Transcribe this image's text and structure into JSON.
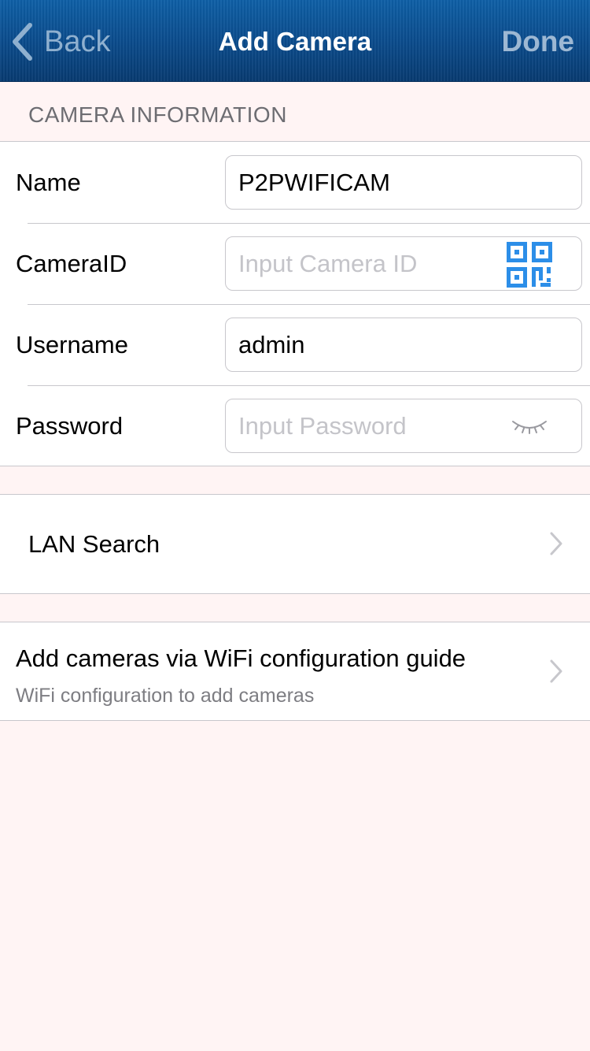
{
  "navbar": {
    "back_label": "Back",
    "title": "Add Camera",
    "done_label": "Done",
    "background_color": "#0a4a8a"
  },
  "section": {
    "header": "CAMERA INFORMATION"
  },
  "form": {
    "name": {
      "label": "Name",
      "value": "P2PWIFICAM",
      "placeholder": ""
    },
    "camera_id": {
      "label": "CameraID",
      "value": "",
      "placeholder": "Input Camera ID",
      "icon": "qr-code-icon"
    },
    "username": {
      "label": "Username",
      "value": "admin",
      "placeholder": ""
    },
    "password": {
      "label": "Password",
      "value": "",
      "placeholder": "Input Password",
      "icon": "eye-closed-icon"
    }
  },
  "lan_search": {
    "title": "LAN Search"
  },
  "wifi_guide": {
    "title": "Add cameras via WiFi configuration guide",
    "subtitle": "WiFi configuration to add cameras"
  },
  "colors": {
    "accent": "#2c8ee8",
    "page_background": "#fff4f4"
  }
}
